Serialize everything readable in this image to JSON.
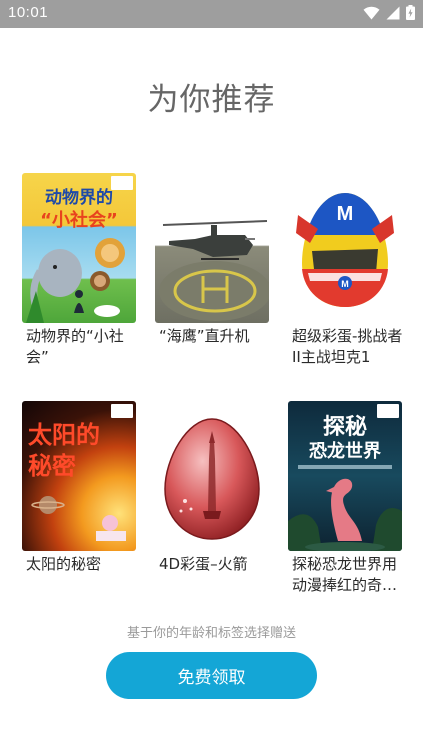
{
  "status_bar": {
    "time": "10:01",
    "icons": [
      "wifi-icon",
      "cellular-signal-icon",
      "battery-charging-icon"
    ]
  },
  "header": {
    "title": "为你推荐"
  },
  "items": [
    {
      "label": "动物界的“小社会”",
      "cover_title": "动物界的",
      "cover_subtitle": "“小社会”",
      "icon": "animal-society-book-cover"
    },
    {
      "label": "“海鹰”直升机",
      "icon": "helicopter-thumbnail"
    },
    {
      "label": "超级彩蛋-挑战者II主战坦克1",
      "icon": "tank-egg-thumbnail"
    },
    {
      "label": "太阳的秘密",
      "cover_title": "太阳的",
      "cover_subtitle": "秘密",
      "icon": "sun-secret-book-cover"
    },
    {
      "label": "4D彩蛋–火箭",
      "icon": "rocket-egg-thumbnail"
    },
    {
      "label": "探秘恐龙世界用动漫捧红的奇幻小说",
      "cover_title": "探秘",
      "cover_subtitle": "恐龙世界",
      "icon": "dinosaur-world-book-cover"
    }
  ],
  "footer": {
    "hint": "基于你的年龄和标签选择赠送",
    "button_label": "免费领取"
  },
  "colors": {
    "accent": "#14a6d6",
    "status_bar": "#9e9e9e",
    "title_text": "#666666"
  }
}
